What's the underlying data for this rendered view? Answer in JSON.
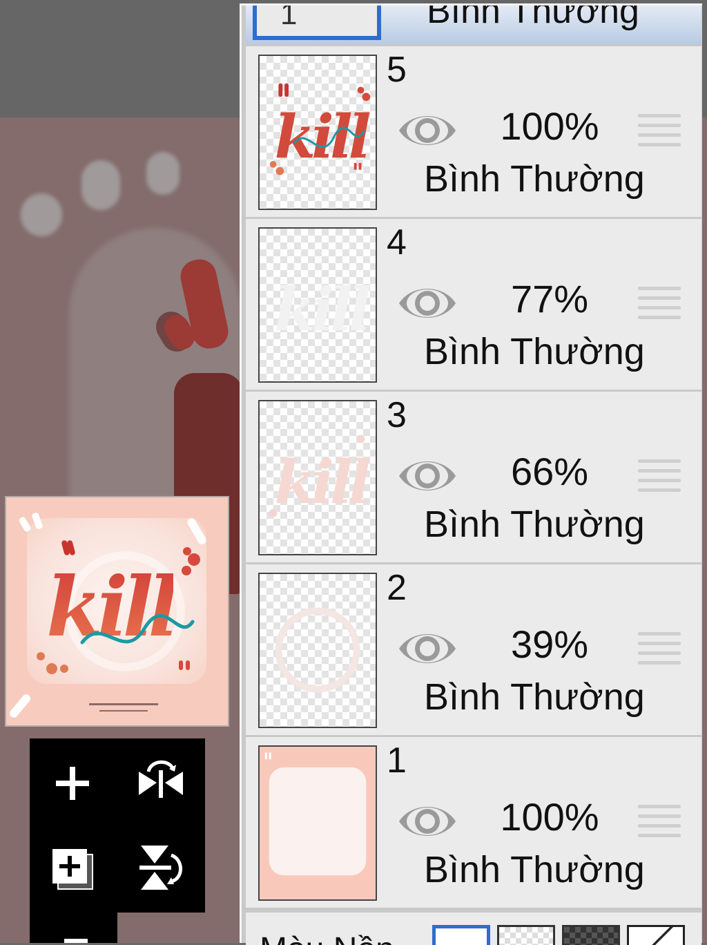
{
  "top_partial_layer": {
    "number": "1",
    "blend_mode": "Bình Thường"
  },
  "layers": [
    {
      "number": "5",
      "opacity": "100%",
      "blend_mode": "Bình Thường",
      "thumbnail": "kill-lettering-colored"
    },
    {
      "number": "4",
      "opacity": "77%",
      "blend_mode": "Bình Thường",
      "thumbnail": "kill-lettering-white"
    },
    {
      "number": "3",
      "opacity": "66%",
      "blend_mode": "Bình Thường",
      "thumbnail": "kill-lettering-pink"
    },
    {
      "number": "2",
      "opacity": "39%",
      "blend_mode": "Bình Thường",
      "thumbnail": "faint-circle"
    },
    {
      "number": "1",
      "opacity": "100%",
      "blend_mode": "Bình Thường",
      "thumbnail": "peach-frame"
    }
  ],
  "bottom_bar": {
    "label": "Màu Nền"
  },
  "canvas_preview": {
    "lettering": "kill"
  },
  "toolbox": {
    "icons": [
      "plus-icon",
      "flip-horizontal-icon",
      "add-layer-icon",
      "flip-vertical-icon"
    ]
  },
  "colors": {
    "accent_selection": "#2f6ccf",
    "panel_row": "#ebebeb",
    "lettering_red": "#d2423b",
    "lettering_teal": "#1b9aa3",
    "thumb_peach": "#f7cbbd"
  }
}
